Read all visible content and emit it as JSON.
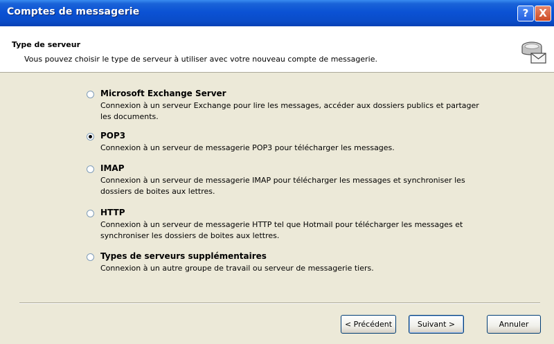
{
  "window": {
    "title": "Comptes de messagerie"
  },
  "titlebar_buttons": {
    "help": "?",
    "close": "X"
  },
  "header": {
    "title": "Type de serveur",
    "subtitle": "Vous pouvez choisir le type de serveur à utiliser avec votre nouveau compte de messagerie.",
    "icon": "mail-server-icon"
  },
  "options": [
    {
      "label": "Microsoft Exchange Server",
      "description": "Connexion à un serveur Exchange pour lire les messages, accéder aux dossiers publics et partager les documents.",
      "selected": false
    },
    {
      "label": "POP3",
      "description": "Connexion à un serveur de messagerie POP3 pour télécharger les messages.",
      "selected": true
    },
    {
      "label": "IMAP",
      "description": "Connexion à un serveur de messagerie IMAP pour télécharger les messages et synchroniser les dossiers de boites aux lettres.",
      "selected": false
    },
    {
      "label": "HTTP",
      "description": "Connexion à un serveur de messagerie HTTP tel que Hotmail pour télécharger les messages et synchroniser les dossiers de boites aux lettres.",
      "selected": false
    },
    {
      "label": "Types de serveurs supplémentaires",
      "description": "Connexion à un autre groupe de travail ou serveur de messagerie tiers.",
      "selected": false
    }
  ],
  "buttons": {
    "previous": "< Précédent",
    "next": "Suivant >",
    "cancel": "Annuler"
  }
}
